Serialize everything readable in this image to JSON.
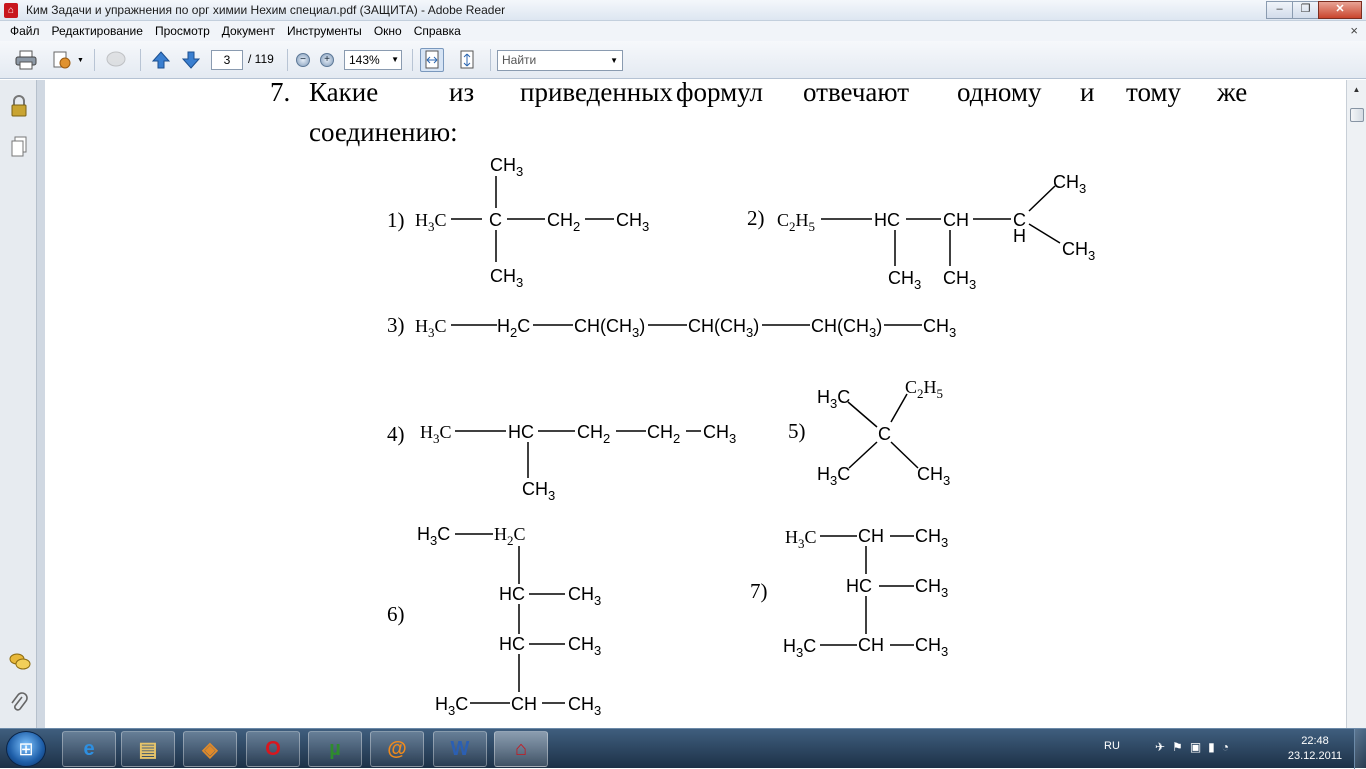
{
  "window": {
    "title": "Ким Задачи и упражнения по орг химии Нехим специал.pdf (ЗАЩИТА) - Adobe Reader",
    "minimize": "–",
    "restore": "❐",
    "close": "✕"
  },
  "menu": {
    "items": [
      "Файл",
      "Редактирование",
      "Просмотр",
      "Документ",
      "Инструменты",
      "Окно",
      "Справка"
    ],
    "close_x": "×"
  },
  "toolbar": {
    "page_current": "3",
    "page_total": "/ 119",
    "zoom": "143%",
    "find_placeholder": "Найти",
    "zoom_out": "−",
    "zoom_in": "+"
  },
  "document": {
    "question_number": "7.",
    "question_line1_words": [
      "Какие",
      "из",
      "приведенных",
      "формул",
      "отвечают",
      "одному",
      "и",
      "тому",
      "же"
    ],
    "question_line2": "соединению:",
    "labels": [
      "1)",
      "2)",
      "3)",
      "4)",
      "5)",
      "6)",
      "7)"
    ],
    "f1": {
      "h3c": "H3C",
      "c": "C",
      "ch2": "CH2",
      "ch3": "CH3"
    },
    "f2": {
      "c2h5": "C2H5",
      "hc": "HC",
      "ch": "CH",
      "c": "C",
      "h": "H",
      "ch3": "CH3"
    },
    "f3": {
      "h3c": "H3C",
      "h2c": "H2C",
      "chch3": "CH(CH3)",
      "ch3": "CH3"
    },
    "f4": {
      "h3c": "H3C",
      "hc": "HC",
      "ch2": "CH2",
      "ch3": "CH3"
    },
    "f5": {
      "h3c": "H3C",
      "c2h5": "C2H5",
      "c": "C",
      "ch3": "CH3"
    },
    "f6": {
      "h3c": "H3C",
      "h2c": "H2C",
      "hc": "HC",
      "ch": "CH",
      "ch3": "CH3"
    },
    "f7": {
      "h3c": "H3C",
      "ch": "CH",
      "hc": "HC",
      "ch3": "CH3"
    }
  },
  "taskbar": {
    "tray_lang": "RU",
    "clock_time": "22:48",
    "clock_date": "23.12.2011"
  },
  "colors": {
    "taskbar": "#2a4560",
    "acrobat_red": "#c8161d",
    "opera_red": "#d8171f",
    "utorrent_green": "#2e8b2e"
  }
}
